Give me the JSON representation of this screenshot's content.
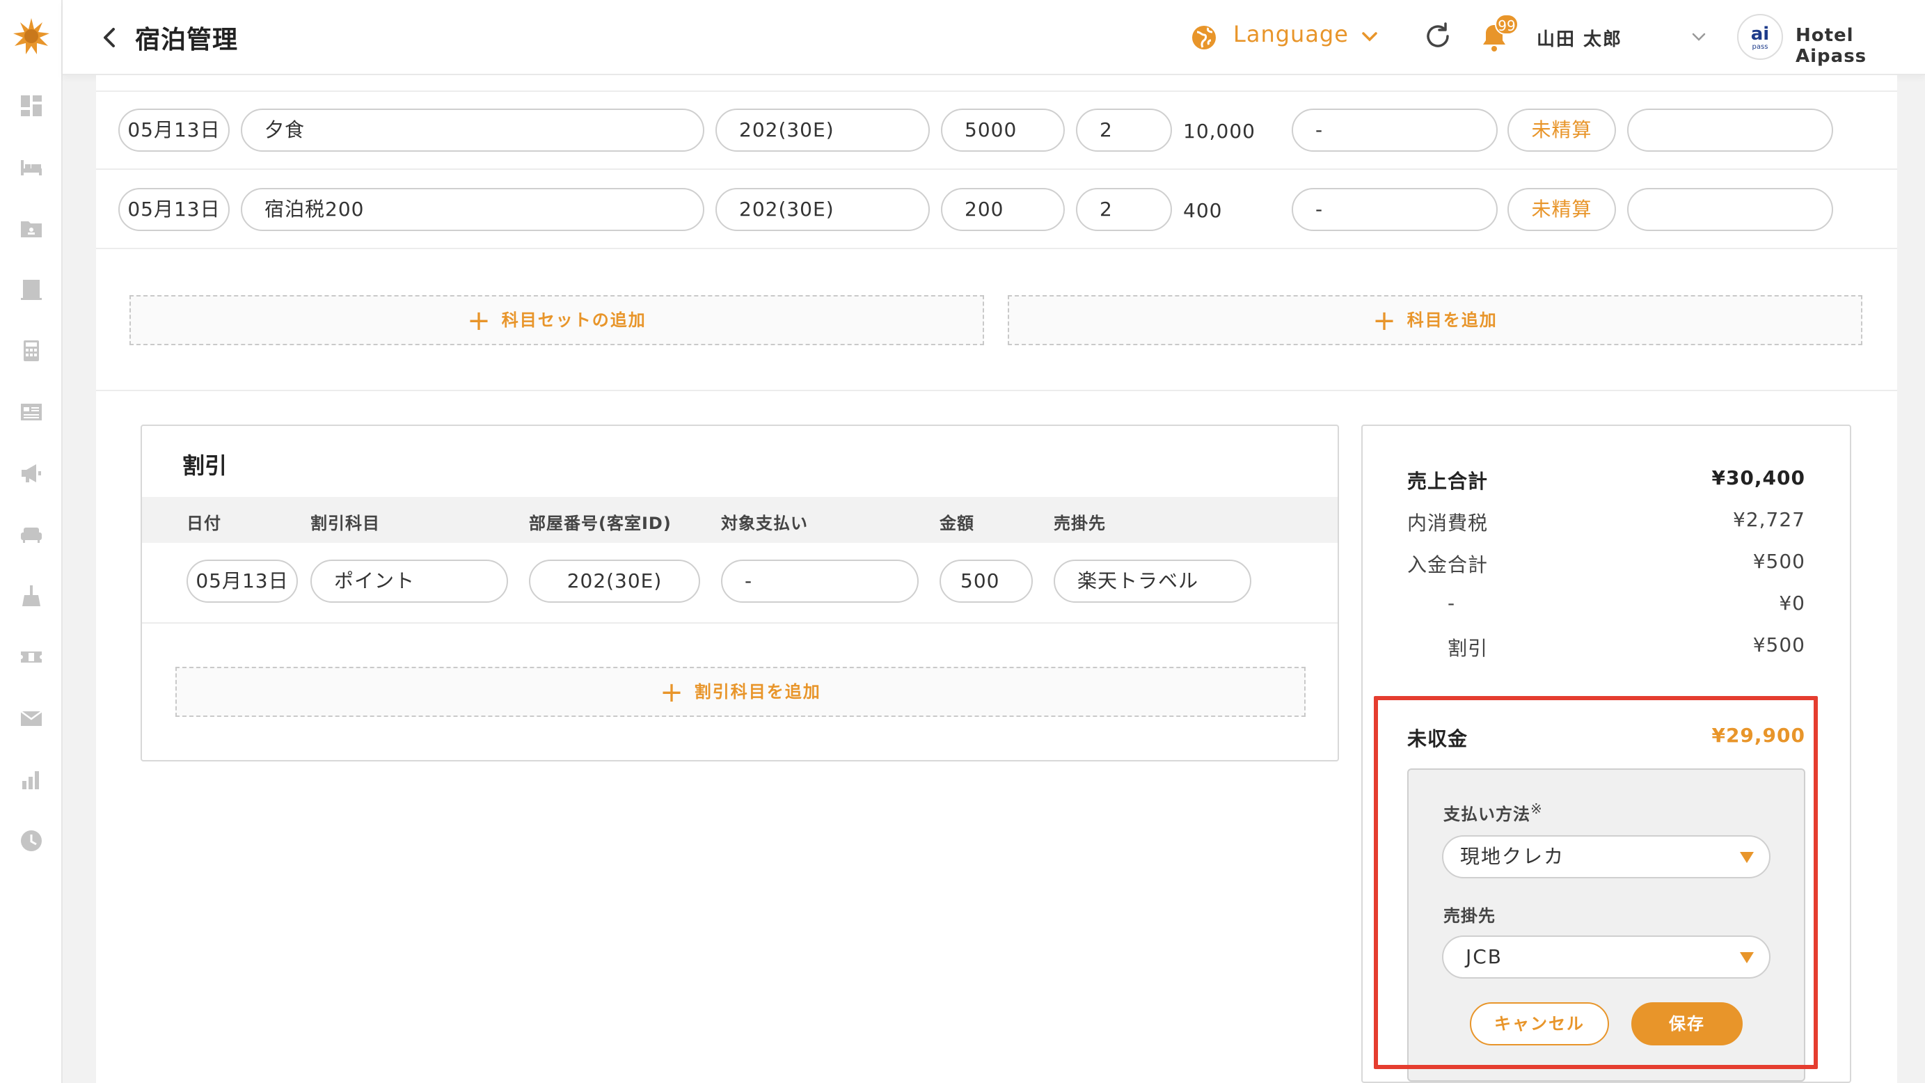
{
  "header": {
    "title": "宿泊管理",
    "language": "Language",
    "notification_count": "99",
    "user_name": "山田 太郎",
    "hotel_logo_text": "ai",
    "hotel_logo_sub": "pass",
    "hotel_name": "Hotel Aipass"
  },
  "items": [
    {
      "date": "05月13日",
      "name": "夕食",
      "room": "202(30E)",
      "price": "5000",
      "qty": "2",
      "amount": "10,000",
      "payment": "-",
      "status": "未精算",
      "extra": ""
    },
    {
      "date": "05月13日",
      "name": "宿泊税200",
      "room": "202(30E)",
      "price": "200",
      "qty": "2",
      "amount": "400",
      "payment": "-",
      "status": "未精算",
      "extra": ""
    }
  ],
  "add_buttons": {
    "add_item_set": "科目セットの追加",
    "add_item": "科目を追加"
  },
  "discount": {
    "title": "割引",
    "columns": [
      "日付",
      "割引科目",
      "部屋番号(客室ID)",
      "対象支払い",
      "金額",
      "売掛先"
    ],
    "row": {
      "date": "05月13日",
      "item": "ポイント",
      "room": "202(30E)",
      "target": "-",
      "amount": "500",
      "account": "楽天トラベル"
    },
    "add_label": "割引科目を追加"
  },
  "summary": {
    "sales_total_label": "売上合計",
    "sales_total_value": "¥30,400",
    "tax_label": "内消費税",
    "tax_value": "¥2,727",
    "payment_total_label": "入金合計",
    "payment_total_value": "¥500",
    "dash_label": "-",
    "dash_value": "¥0",
    "discount_label": "割引",
    "discount_value": "¥500",
    "unpaid_label": "未収金",
    "unpaid_value": "¥29,900"
  },
  "payment_form": {
    "method_label": "支払い方法",
    "method_note": "※",
    "method_value": "現地クレカ",
    "account_label": "売掛先",
    "account_value": "JCB",
    "cancel_label": "キャンセル",
    "save_label": "保存"
  },
  "colors": {
    "accent": "#e8952a",
    "highlight": "#e53d2f"
  }
}
